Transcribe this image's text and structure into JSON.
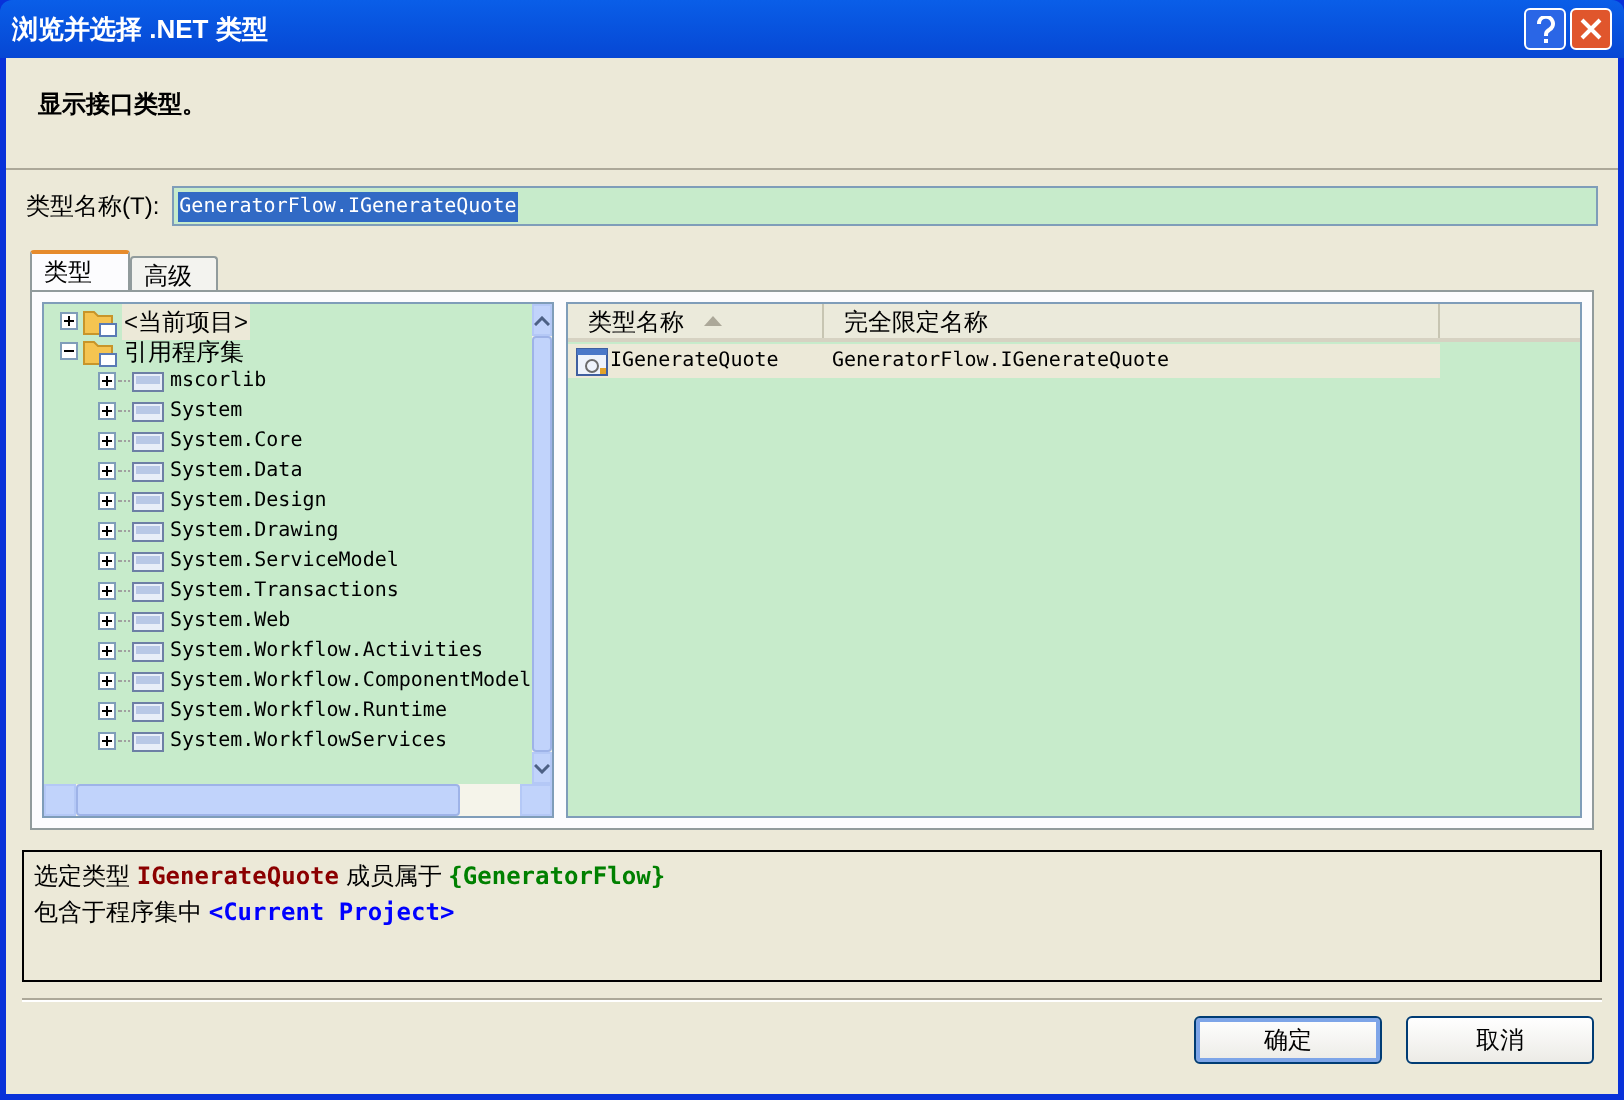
{
  "window": {
    "title": "浏览并选择 .NET 类型"
  },
  "header": {
    "text": "显示接口类型。"
  },
  "type_name": {
    "label": "类型名称(T):",
    "value": "GeneratorFlow.IGenerateQuote"
  },
  "tabs": [
    {
      "label": "类型",
      "selected": true
    },
    {
      "label": "高级",
      "selected": false
    }
  ],
  "tree": [
    {
      "label": "<当前项目>",
      "expanded": false,
      "selected": true
    },
    {
      "label": "引用程序集",
      "expanded": true,
      "selected": false,
      "children": [
        {
          "label": "mscorlib",
          "expanded": false
        },
        {
          "label": "System",
          "expanded": false
        },
        {
          "label": "System.Core",
          "expanded": false
        },
        {
          "label": "System.Data",
          "expanded": false
        },
        {
          "label": "System.Design",
          "expanded": false
        },
        {
          "label": "System.Drawing",
          "expanded": false
        },
        {
          "label": "System.ServiceModel",
          "expanded": false
        },
        {
          "label": "System.Transactions",
          "expanded": false
        },
        {
          "label": "System.Web",
          "expanded": false
        },
        {
          "label": "System.Workflow.Activities",
          "expanded": false
        },
        {
          "label": "System.Workflow.ComponentModel",
          "expanded": false
        },
        {
          "label": "System.Workflow.Runtime",
          "expanded": false
        },
        {
          "label": "System.WorkflowServices",
          "expanded": false
        }
      ]
    }
  ],
  "table": {
    "columns": [
      {
        "label": "类型名称",
        "sorted": true
      },
      {
        "label": "完全限定名称",
        "sorted": false
      }
    ],
    "rows": [
      {
        "cells": [
          "IGenerateQuote",
          "GeneratorFlow.IGenerateQuote"
        ],
        "selected": true
      }
    ]
  },
  "description": [
    [
      {
        "kind": "plain",
        "text": "选定类型 "
      },
      {
        "kind": "type",
        "text": "IGenerateQuote"
      },
      {
        "kind": "plain",
        "text": " 成员属于 "
      },
      {
        "kind": "namespace",
        "text": "{GeneratorFlow}"
      }
    ],
    [
      {
        "kind": "plain",
        "text": "包含于程序集中 "
      },
      {
        "kind": "assembly",
        "text": "<Current Project>"
      }
    ]
  ],
  "buttons": [
    {
      "label": "确定",
      "default": true
    },
    {
      "label": "取消",
      "default": false
    }
  ]
}
